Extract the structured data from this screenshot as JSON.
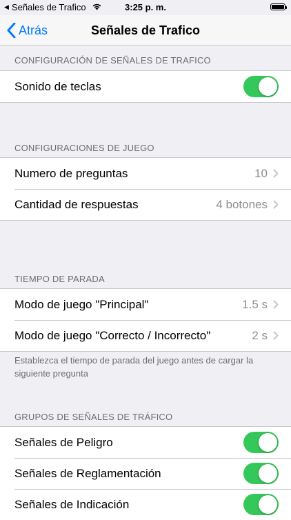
{
  "status_bar": {
    "back_app": "Señales de Trafico",
    "time": "3:25 p. m."
  },
  "nav": {
    "back_label": "Atrás",
    "title": "Señales de Trafico"
  },
  "sections": {
    "config": {
      "header": "CONFIGURACIÓN DE SEÑALES DE TRAFICO",
      "rows": [
        {
          "label": "Sonido de teclas",
          "on": true
        }
      ]
    },
    "juego": {
      "header": "CONFIGURACIONES DE JUEGO",
      "rows": [
        {
          "label": "Numero de preguntas",
          "value": "10"
        },
        {
          "label": "Cantidad de respuestas",
          "value": "4 botones"
        }
      ]
    },
    "parada": {
      "header": "TIEMPO DE PARADA",
      "rows": [
        {
          "label": "Modo de juego \"Principal\"",
          "value": "1.5 s"
        },
        {
          "label": "Modo de juego \"Correcto / Incorrecto\"",
          "value": "2 s"
        }
      ],
      "footer": "Establezca el tiempo de parada del juego antes de cargar la siguiente pregunta"
    },
    "grupos": {
      "header": "GRUPOS DE SEÑALES DE TRÁFICO",
      "rows": [
        {
          "label": "Señales de Peligro",
          "on": true
        },
        {
          "label": "Señales de Reglamentación",
          "on": true
        },
        {
          "label": "Señales de Indicación",
          "on": true
        }
      ]
    }
  },
  "colors": {
    "accent": "#007aff",
    "toggle_on": "#34c759",
    "background": "#efeff4"
  }
}
